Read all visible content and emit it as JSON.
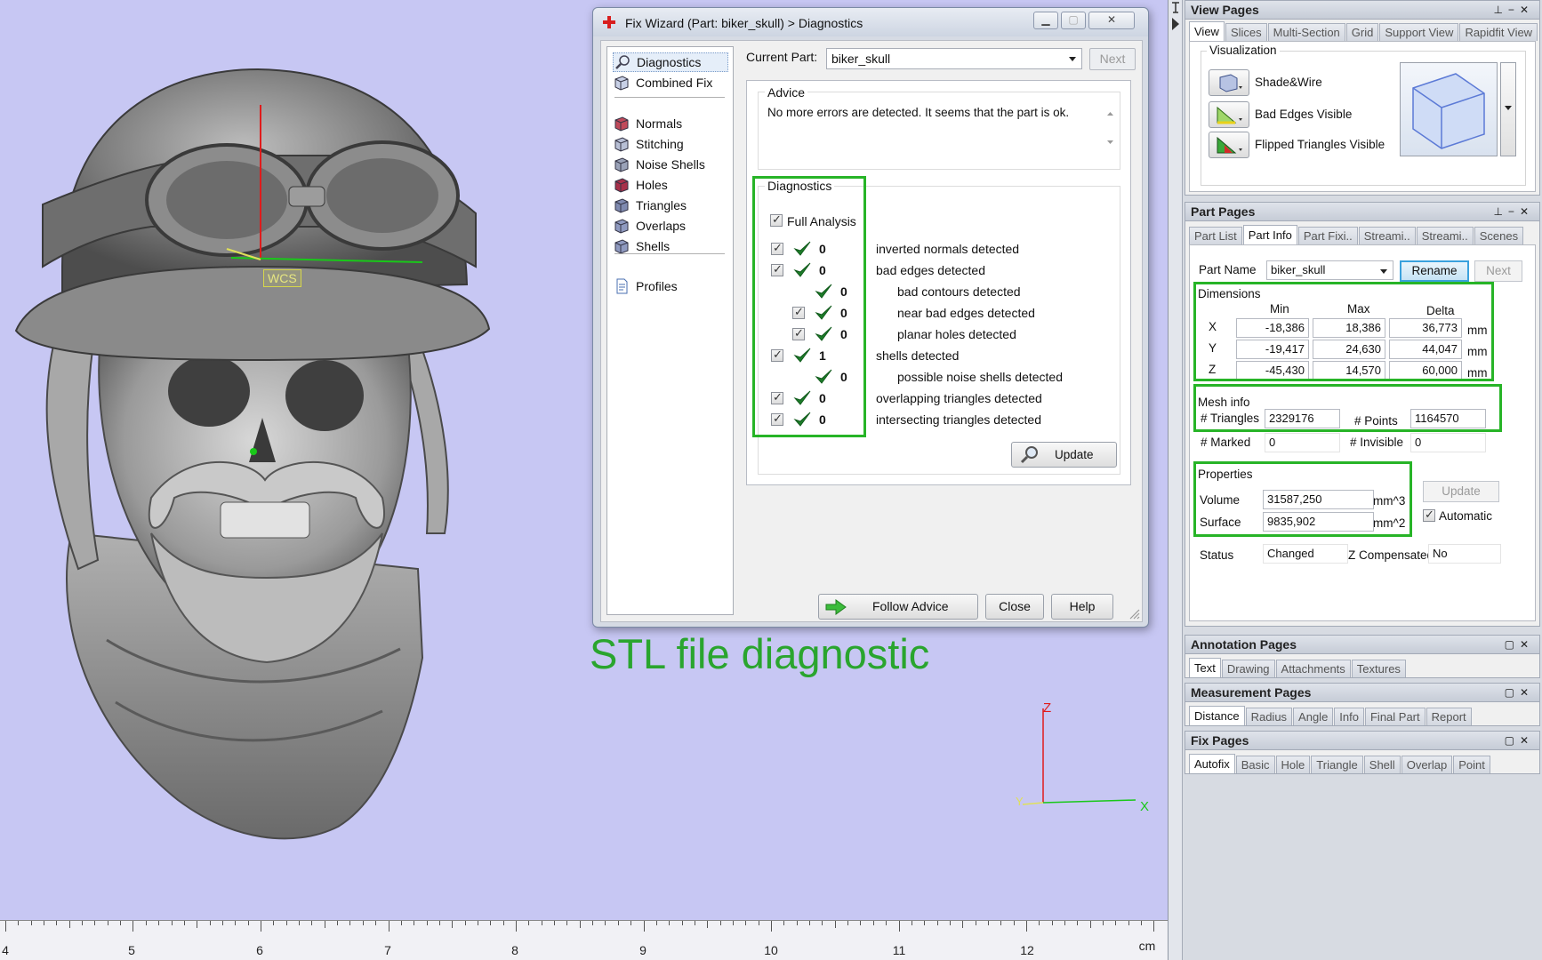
{
  "viewport": {
    "wcs_label": "WCS",
    "axis_labels": {
      "x": "X",
      "y": "Y",
      "z": "Z"
    },
    "caption": "STL file diagnostic",
    "ruler": {
      "unit": "cm",
      "labels": [
        "4",
        "5",
        "6",
        "7",
        "8",
        "9",
        "10",
        "11",
        "12"
      ]
    }
  },
  "dialog": {
    "title": "Fix Wizard (Part: biker_skull) > Diagnostics",
    "nav": [
      {
        "label": "Diagnostics",
        "icon": "magnifier-icon"
      },
      {
        "label": "Combined Fix",
        "icon": "cube-icon"
      },
      {
        "label": "Normals",
        "icon": "cube-icon"
      },
      {
        "label": "Stitching",
        "icon": "cube-icon"
      },
      {
        "label": "Noise Shells",
        "icon": "cube-icon"
      },
      {
        "label": "Holes",
        "icon": "cube-icon"
      },
      {
        "label": "Triangles",
        "icon": "cube-icon"
      },
      {
        "label": "Overlaps",
        "icon": "cube-icon"
      },
      {
        "label": "Shells",
        "icon": "cube-icon"
      },
      {
        "label": "Profiles",
        "icon": "document-icon"
      }
    ],
    "current_part_label": "Current Part:",
    "current_part_value": "biker_skull",
    "next_label": "Next",
    "advice_legend": "Advice",
    "advice_text": "No more errors are detected. It seems that the part is ok.",
    "diagnostics_legend": "Diagnostics",
    "full_analysis_label": "Full Analysis",
    "rows": [
      {
        "count": "0",
        "label": "inverted normals detected"
      },
      {
        "count": "0",
        "label": "bad edges detected"
      },
      {
        "count": "0",
        "label": "bad contours detected"
      },
      {
        "count": "0",
        "label": "near bad edges detected"
      },
      {
        "count": "0",
        "label": "planar holes detected"
      },
      {
        "count": "1",
        "label": "shells detected"
      },
      {
        "count": "0",
        "label": "possible noise shells detected"
      },
      {
        "count": "0",
        "label": "overlapping triangles detected"
      },
      {
        "count": "0",
        "label": "intersecting triangles detected"
      }
    ],
    "update_label": "Update",
    "follow_advice_label": "Follow Advice",
    "close_label": "Close",
    "help_label": "Help"
  },
  "view_pages": {
    "title": "View Pages",
    "tabs": [
      "View",
      "Slices",
      "Multi-Section",
      "Grid",
      "Support View",
      "Rapidfit View"
    ],
    "visualization_legend": "Visualization",
    "items": [
      "Shade&Wire",
      "Bad Edges Visible",
      "Flipped Triangles Visible"
    ]
  },
  "part_pages": {
    "title": "Part Pages",
    "tabs": [
      "Part List",
      "Part Info",
      "Part Fixi..",
      "Streami..",
      "Streami..",
      "Scenes"
    ],
    "part_name_label": "Part Name",
    "part_name_value": "biker_skull",
    "rename_label": "Rename",
    "next_label": "Next",
    "dimensions_legend": "Dimensions",
    "dim_headers": [
      "Min",
      "Max",
      "Delta"
    ],
    "dim_rows": [
      {
        "axis": "X",
        "min": "-18,386",
        "max": "18,386",
        "delta": "36,773",
        "unit": "mm"
      },
      {
        "axis": "Y",
        "min": "-19,417",
        "max": "24,630",
        "delta": "44,047",
        "unit": "mm"
      },
      {
        "axis": "Z",
        "min": "-45,430",
        "max": "14,570",
        "delta": "60,000",
        "unit": "mm"
      }
    ],
    "mesh_legend": "Mesh info",
    "triangles_label": "# Triangles",
    "triangles_value": "2329176",
    "points_label": "# Points",
    "points_value": "1164570",
    "marked_label": "# Marked",
    "marked_value": "0",
    "invisible_label": "# Invisible",
    "invisible_value": "0",
    "properties_legend": "Properties",
    "volume_label": "Volume",
    "volume_value": "31587,250",
    "volume_unit": "mm^3",
    "surface_label": "Surface",
    "surface_value": "9835,902",
    "surface_unit": "mm^2",
    "update_label": "Update",
    "automatic_label": "Automatic",
    "status_label": "Status",
    "status_value": "Changed",
    "zcomp_label": "Z Compensated",
    "zcomp_value": "No"
  },
  "annotation_pages": {
    "title": "Annotation Pages",
    "tabs": [
      "Text",
      "Drawing",
      "Attachments",
      "Textures"
    ]
  },
  "measurement_pages": {
    "title": "Measurement Pages",
    "tabs": [
      "Distance",
      "Radius",
      "Angle",
      "Info",
      "Final Part",
      "Report"
    ]
  },
  "fix_pages": {
    "title": "Fix Pages",
    "tabs": [
      "Autofix",
      "Basic",
      "Hole",
      "Triangle",
      "Shell",
      "Overlap",
      "Point"
    ]
  },
  "colors": {
    "viewport_bg": "#c7c7f3",
    "highlight_green": "#27b427",
    "caption_green": "#2aa52e"
  }
}
